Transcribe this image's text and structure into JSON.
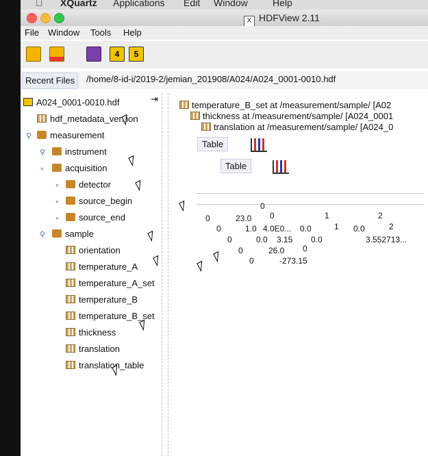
{
  "os_menubar": {
    "apple": "",
    "app": "XQuartz",
    "items": [
      "Applications",
      "Edit",
      "Window",
      "Help"
    ]
  },
  "window": {
    "title": "HDFView 2.11",
    "title_glyph": "X"
  },
  "menu": [
    "File",
    "Window",
    "Tools",
    "Help"
  ],
  "toolbar": {
    "icons": [
      "open-file-icon",
      "open-folder-icon",
      "help-book-icon",
      "user-guide-4-icon",
      "user-guide-5-icon"
    ],
    "guide_labels": [
      "4",
      "5"
    ]
  },
  "recent": {
    "label": "Recent Files",
    "path": "/home/8-id-i/2019-2/jemian_201908/A024/A024_0001-0010.hdf"
  },
  "tree": {
    "root": "A024_0001-0010.hdf",
    "items": [
      {
        "label": "hdf_metadata_version",
        "icon": "dataset"
      },
      {
        "label": "measurement",
        "icon": "folder"
      },
      {
        "label": "instrument",
        "icon": "folder"
      },
      {
        "label": "acquisition",
        "icon": "folder"
      },
      {
        "label": "detector",
        "icon": "folder"
      },
      {
        "label": "source_begin",
        "icon": "folder"
      },
      {
        "label": "source_end",
        "icon": "folder"
      },
      {
        "label": "sample",
        "icon": "folder"
      },
      {
        "label": "orientation",
        "icon": "dataset"
      },
      {
        "label": "temperature_A",
        "icon": "dataset"
      },
      {
        "label": "temperature_A_set",
        "icon": "dataset"
      },
      {
        "label": "temperature_B",
        "icon": "dataset"
      },
      {
        "label": "temperature_B_set",
        "icon": "dataset"
      },
      {
        "label": "thickness",
        "icon": "dataset"
      },
      {
        "label": "translation",
        "icon": "dataset"
      },
      {
        "label": "translation_table",
        "icon": "dataset"
      }
    ]
  },
  "frames": [
    {
      "title": "temperature_B_set  at  /measurement/sample/  [A02"
    },
    {
      "title": "thickness  at  /measurement/sample/  [A024_0001"
    },
    {
      "title": "translation  at  /measurement/sample/  [A024_0"
    }
  ],
  "tabs": [
    "Table",
    "Table"
  ],
  "cells": [
    "0",
    "0",
    "23.0",
    "0",
    "1",
    "2",
    "0",
    "1.0",
    "4.0E0...",
    "0.0",
    "1",
    "0.0",
    "2",
    "0",
    "0.0",
    "3.15",
    "0.0",
    "3.552713...",
    "0",
    "26.0",
    "0",
    "0",
    "-273.15"
  ]
}
